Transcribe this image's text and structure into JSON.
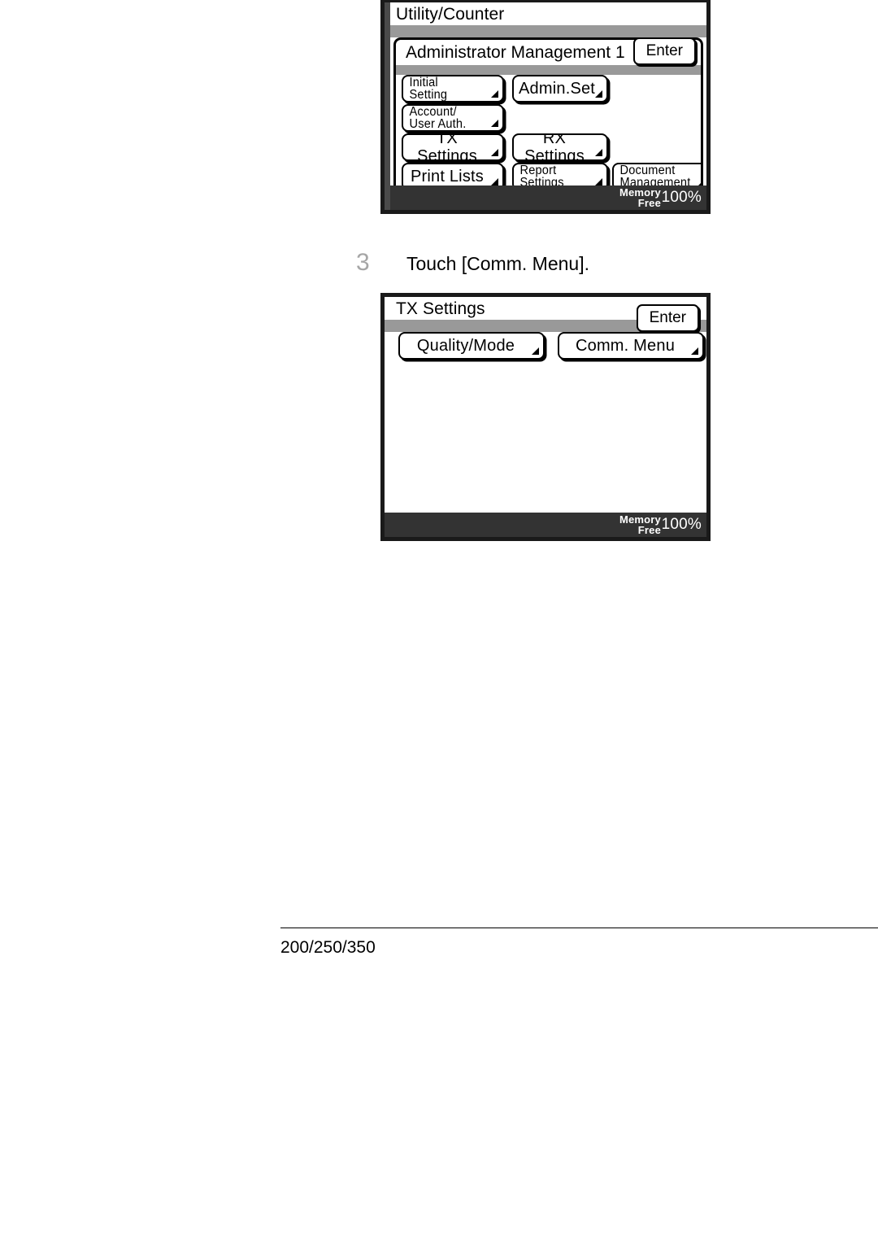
{
  "page": {
    "footer_rule": true,
    "footer_text": "200/250/350",
    "background": "#ffffff"
  },
  "colors": {
    "gray_band": "#999999",
    "footer_bar": "#333333",
    "step_number": "#a6a6a6",
    "border": "#000000"
  },
  "step": {
    "number": "3",
    "text": "Touch [Comm. Menu]."
  },
  "screen1": {
    "name": "utility-counter-screen",
    "title": "Utility/Counter",
    "inner": {
      "title": "Administrator Management 1",
      "enter_label": "Enter",
      "keys": [
        {
          "label": "Initial\nSetting",
          "name": "key-initial-setting",
          "lines": 2
        },
        {
          "label": "Admin.Set",
          "name": "key-admin-set",
          "lines": 1
        },
        {
          "label": "Account/\nUser Auth.",
          "name": "key-account-user-auth",
          "lines": 2
        },
        {
          "label": "TX Settings",
          "name": "key-tx-settings",
          "lines": 1
        },
        {
          "label": "RX Settings",
          "name": "key-rx-settings",
          "lines": 1
        },
        {
          "label": "Print Lists",
          "name": "key-print-lists",
          "lines": 1
        },
        {
          "label": "Report\nSettings",
          "name": "key-report-settings",
          "lines": 2
        },
        {
          "label": "Document\nManagement",
          "name": "key-document-management",
          "lines": 2
        }
      ]
    },
    "memory_label": "Memory\nFree",
    "memory_value": "100%"
  },
  "screen2": {
    "name": "tx-settings-screen",
    "title": "TX Settings",
    "enter_label": "Enter",
    "keys": [
      {
        "label": "Quality/Mode",
        "name": "key-quality-mode",
        "lines": 1
      },
      {
        "label": "Comm. Menu",
        "name": "key-comm-menu",
        "lines": 1
      }
    ],
    "memory_label": "Memory\nFree",
    "memory_value": "100%"
  }
}
